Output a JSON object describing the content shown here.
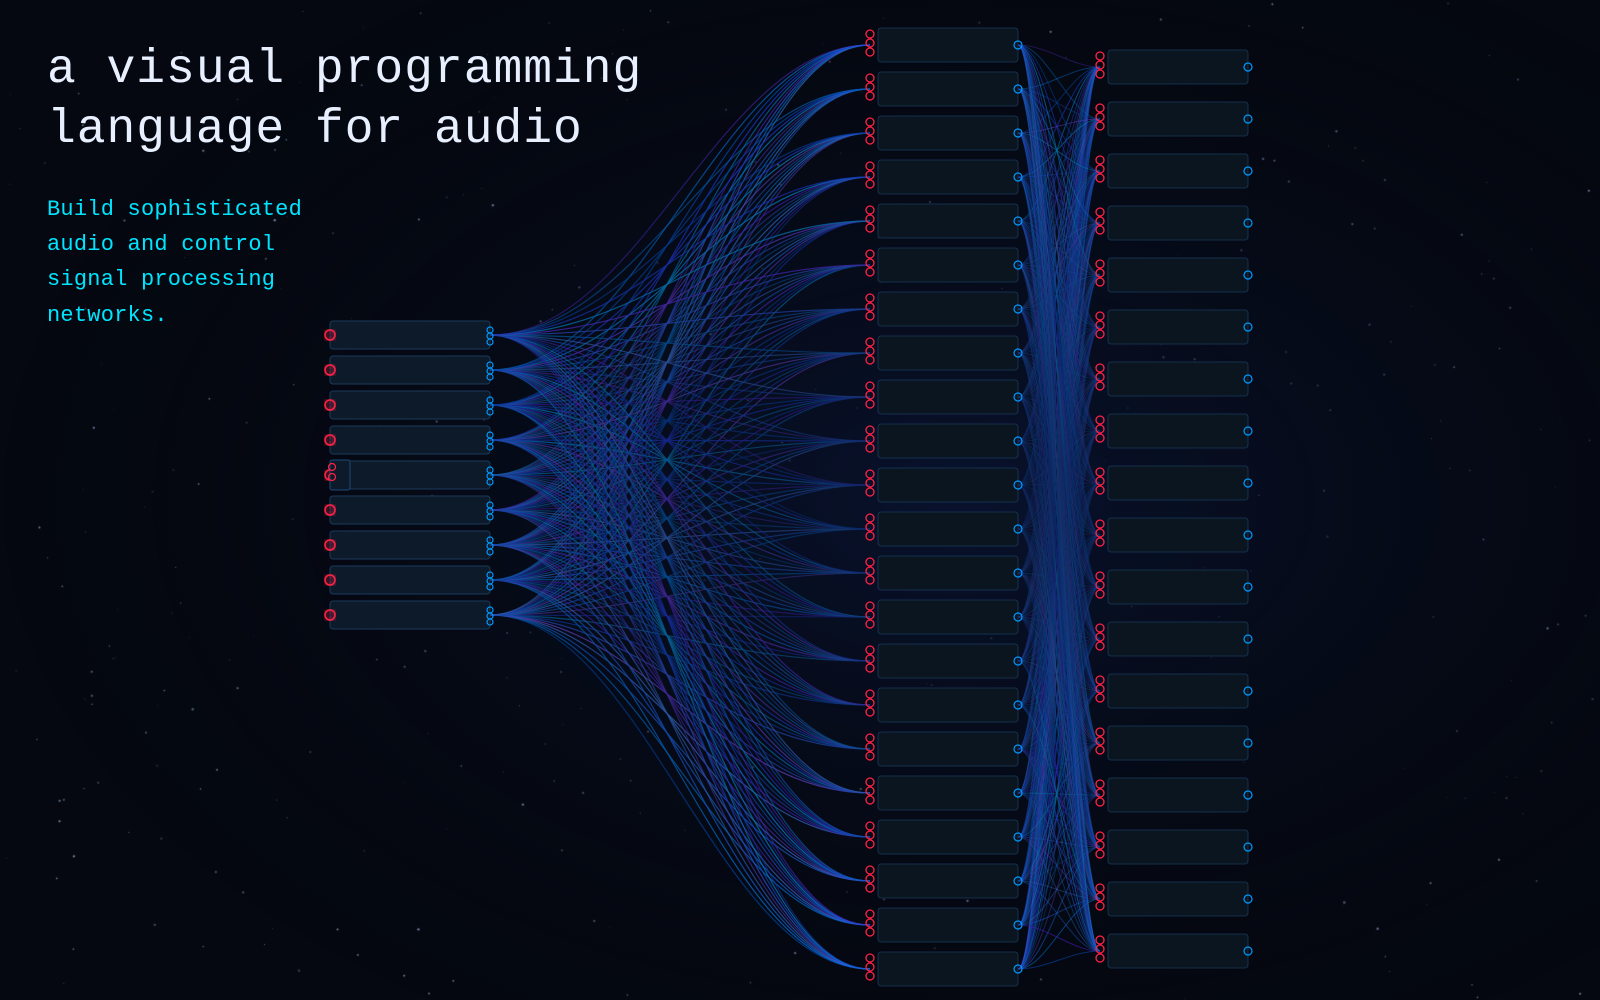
{
  "headline": {
    "line1": "a visual programming",
    "line2": "language for audio"
  },
  "subtitle": {
    "line1": "Build sophisticated",
    "line2": "audio and control",
    "line3": "signal processing",
    "line4": "networks."
  },
  "colors": {
    "background": "#050810",
    "headline": "#e8f0ff",
    "subtitle": "#00e5ff",
    "wire_blue": "#1a6fff",
    "wire_cyan": "#00cfff",
    "wire_purple": "#6633ff",
    "node_port_red": "#ff2244",
    "node_bg": "#0d1520",
    "node_border": "#1a3a5c"
  }
}
